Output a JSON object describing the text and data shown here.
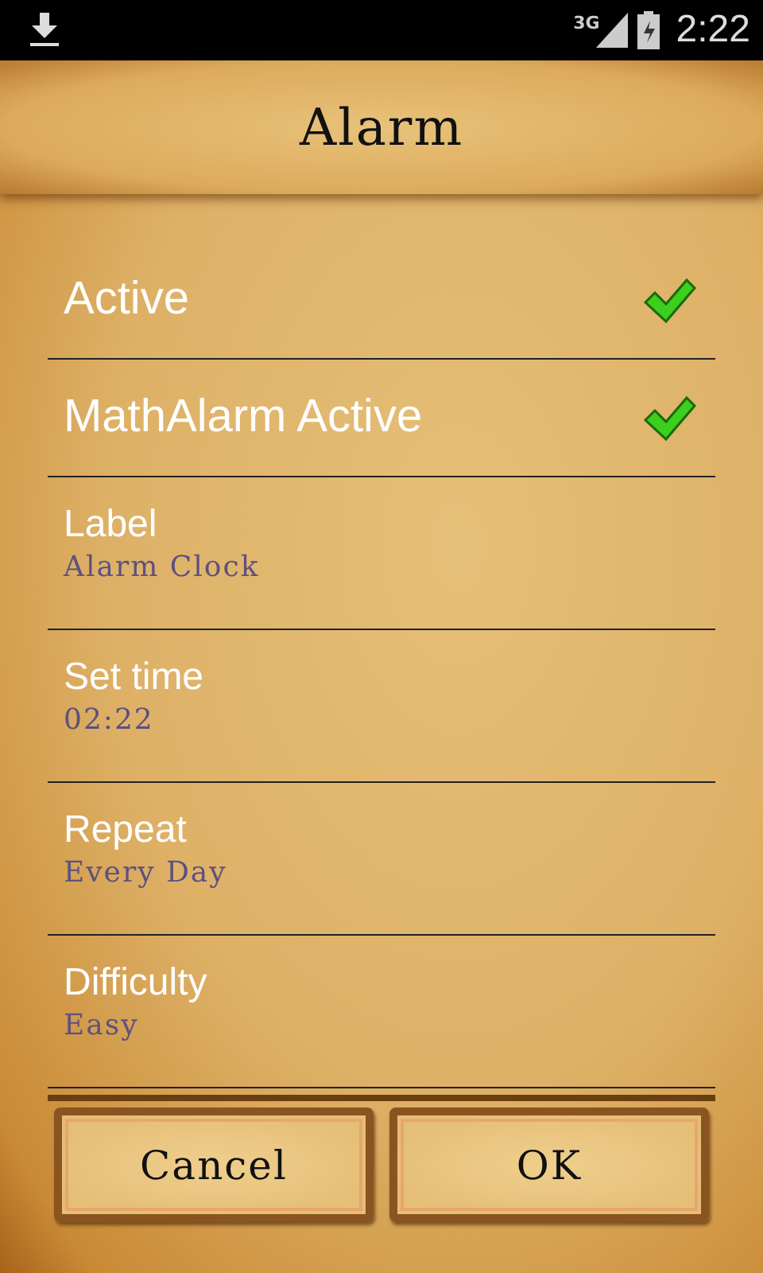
{
  "status_bar": {
    "network": "3G",
    "time": "2:22"
  },
  "header": {
    "title": "Alarm"
  },
  "settings": [
    {
      "kind": "check",
      "label": "Active",
      "checked": true
    },
    {
      "kind": "check",
      "label": "MathAlarm Active",
      "checked": true
    },
    {
      "kind": "value",
      "label": "Label",
      "value": "Alarm Clock"
    },
    {
      "kind": "value",
      "label": "Set time",
      "value": "02:22"
    },
    {
      "kind": "value",
      "label": "Repeat",
      "value": "Every Day"
    },
    {
      "kind": "value",
      "label": "Difficulty",
      "value": "Easy"
    }
  ],
  "buttons": [
    "Cancel",
    "OK"
  ]
}
